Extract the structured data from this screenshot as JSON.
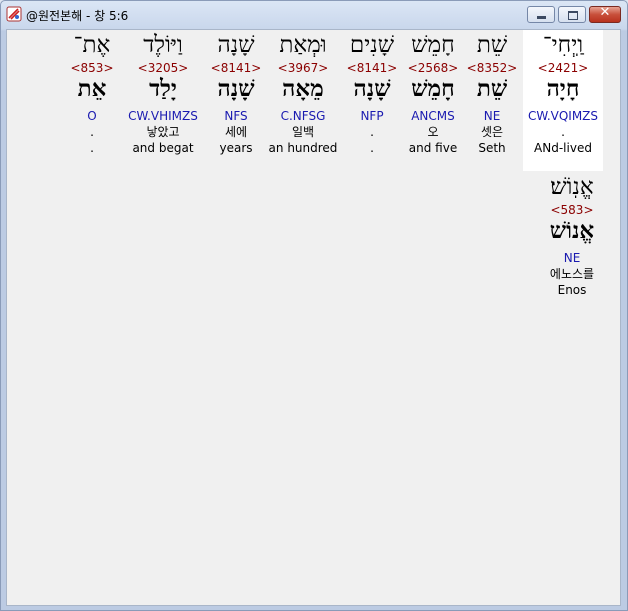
{
  "window": {
    "title": "@원전본해 - 창 5:6"
  },
  "controls": {
    "close_glyph": "✕"
  },
  "words": [
    {
      "hebrew": "וַֽיְחִי־",
      "strong": "<2421>",
      "lemma": "חָיָה",
      "morph": "CW.VQIMZS",
      "korean": ".",
      "english": "ANd-lived"
    },
    {
      "hebrew": "שֵׁת",
      "strong": "<8352>",
      "lemma": "שֵׁת",
      "morph": "NE",
      "korean": "셋은",
      "english": "Seth"
    },
    {
      "hebrew": "חָמֵשׁ",
      "strong": "<2568>",
      "lemma": "חָמֵשׁ",
      "morph": "ANCMS",
      "korean": "오",
      "english": "and five"
    },
    {
      "hebrew": "שָׁנִים",
      "strong": "<8141>",
      "lemma": "שָׁנָה",
      "morph": "NFP",
      "korean": ".",
      "english": "."
    },
    {
      "hebrew": "וּמְאַת",
      "strong": "<3967>",
      "lemma": "מֵאָה",
      "morph": "C.NFSG",
      "korean": "일백",
      "english": "an hundred"
    },
    {
      "hebrew": "שָׁנָה",
      "strong": "<8141>",
      "lemma": "שָׁנָה",
      "morph": "NFS",
      "korean": "세에",
      "english": "years"
    },
    {
      "hebrew": "וַיּוֹלֶד",
      "strong": "<3205>",
      "lemma": "יָלַד",
      "morph": "CW.VHIMZS",
      "korean": "낳았고",
      "english": "and begat"
    },
    {
      "hebrew": "אֶת־",
      "strong": "<853>",
      "lemma": "אֵת",
      "morph": "O",
      "korean": ".",
      "english": "."
    },
    {
      "hebrew": "אֱנֽוֹשׁ׃",
      "strong": "<583>",
      "lemma": "אֱנוֹשׁ",
      "morph": "NE",
      "korean": "에노스를",
      "english": "Enos"
    }
  ]
}
